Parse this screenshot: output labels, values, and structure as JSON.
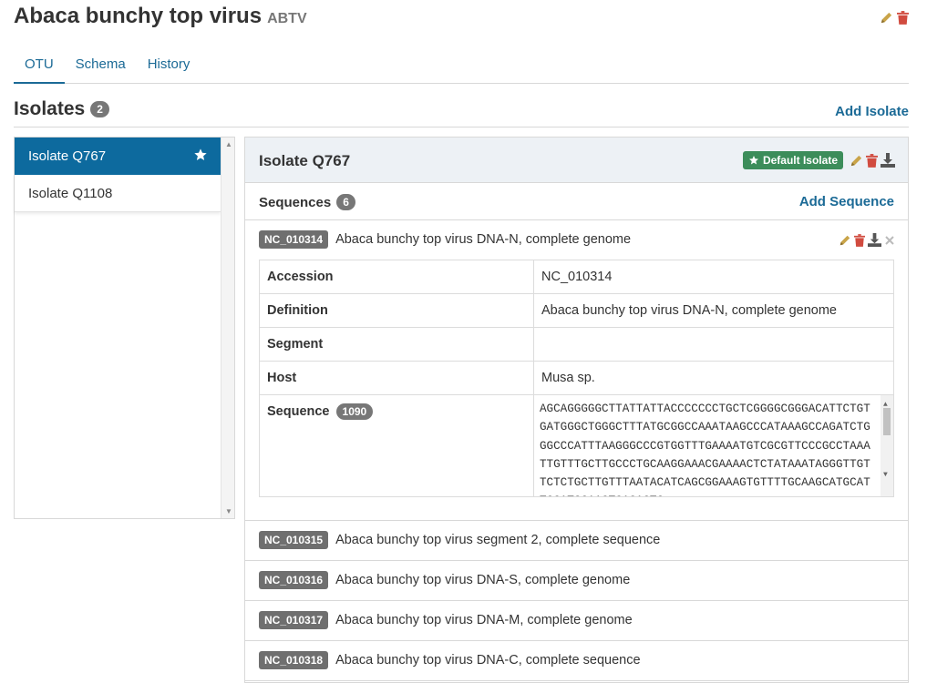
{
  "header": {
    "title": "Abaca bunchy top virus",
    "abbreviation": "ABTV",
    "edit_icon": "pencil-icon",
    "delete_icon": "trash-icon"
  },
  "tabs": [
    {
      "label": "OTU",
      "active": true
    },
    {
      "label": "Schema",
      "active": false
    },
    {
      "label": "History",
      "active": false
    }
  ],
  "isolates": {
    "title": "Isolates",
    "count": "2",
    "add_label": "Add Isolate",
    "items": [
      {
        "label": "Isolate Q767",
        "active": true,
        "default": true
      },
      {
        "label": "Isolate Q1108",
        "active": false,
        "default": false
      }
    ]
  },
  "detail": {
    "title": "Isolate Q767",
    "default_label": "Default Isolate",
    "sequences_title": "Sequences",
    "sequences_count": "6",
    "add_sequence_label": "Add Sequence",
    "expanded": {
      "accession_badge": "NC_010314",
      "name": "Abaca bunchy top virus DNA-N, complete genome",
      "fields": [
        {
          "key": "Accession",
          "value": "NC_010314"
        },
        {
          "key": "Definition",
          "value": "Abaca bunchy top virus DNA-N, complete genome"
        },
        {
          "key": "Segment",
          "value": ""
        },
        {
          "key": "Host",
          "value": "Musa sp."
        }
      ],
      "sequence_label": "Sequence",
      "sequence_length": "1090",
      "sequence_text": "AGCAGGGGGCTTATTATTACCCCCCCTGCTCGGGGCGGGACATTCTGTGATGGGCTGGGCTTTATGCGGCCAAATAAGCCCATAAAGCCAGATCTGGGCCCATTTAAGGGCCCGTGGTTTGAAAATGTCGCGTTCCCGCCTAAATTGTTTGCTTGCCCTGCAAGGAAACGAAAACTCTATAAATAGGGTTGTTCTCTGCTTGTTTAATACATCAGCGGAAAGTGTTTTGCAAGCATGCATTGCATGGAAGTGAGAGTG"
    },
    "sequences": [
      {
        "accession": "NC_010315",
        "name": "Abaca bunchy top virus segment 2, complete sequence"
      },
      {
        "accession": "NC_010316",
        "name": "Abaca bunchy top virus DNA-S, complete genome"
      },
      {
        "accession": "NC_010317",
        "name": "Abaca bunchy top virus DNA-M, complete genome"
      },
      {
        "accession": "NC_010318",
        "name": "Abaca bunchy top virus DNA-C, complete sequence"
      }
    ]
  },
  "colors": {
    "primary": "#1b6a96",
    "active_bg": "#0d6a9e",
    "edit": "#c9a449",
    "delete": "#d14b3f",
    "download": "#555555",
    "default_badge": "#3c8d5a"
  }
}
